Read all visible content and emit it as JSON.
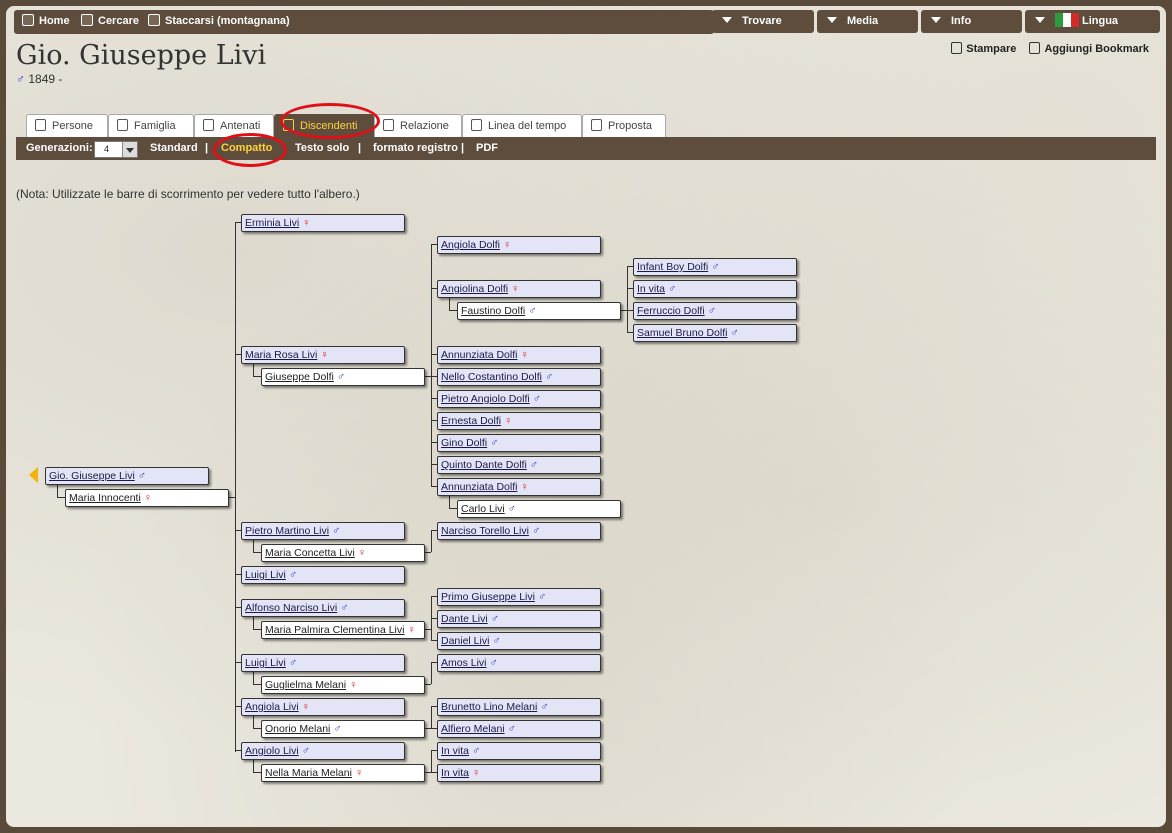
{
  "menu": {
    "home": "Home",
    "search": "Cercare",
    "logout": "Staccarsi (montagnana)",
    "find": "Trovare",
    "media": "Media",
    "info": "Info",
    "language": "Lingua"
  },
  "person": {
    "name": "Gio. Giuseppe Livi",
    "sex_symbol": "♂",
    "dates": "1849 -"
  },
  "header_links": {
    "print": "Stampare",
    "bookmark": "Aggiungi Bookmark"
  },
  "tabs": [
    "Persone",
    "Famiglia",
    "Antenati",
    "Discendenti",
    "Relazione",
    "Linea del tempo",
    "Proposta"
  ],
  "active_tab": "Discendenti",
  "subnav": {
    "generations_label": "Generazioni:",
    "generations_value": "4",
    "sep": "|",
    "options": [
      "Standard",
      "Compatto",
      "Testo solo",
      "formato registro",
      "PDF"
    ],
    "active_option": "Compatto"
  },
  "note": "(Nota: Utilizzate le barre di scorrimento per vedere tutto l'albero.)",
  "highlight_color": "#e0101a",
  "active_color": "#ffd23a",
  "tree": [
    {
      "name": "Gio. Giuseppe Livi",
      "sex": "♂",
      "type": "person"
    },
    {
      "name": "Maria Innocenti",
      "sex": "♀",
      "type": "spouse"
    },
    {
      "name": "Erminia Livi",
      "sex": "♀",
      "type": "person"
    },
    {
      "name": "Maria Rosa Livi",
      "sex": "♀",
      "type": "person"
    },
    {
      "name": "Giuseppe Dolfi",
      "sex": "♂",
      "type": "spouse"
    },
    {
      "name": "Angiola Dolfi",
      "sex": "♀",
      "type": "person"
    },
    {
      "name": "Angiolina Dolfi",
      "sex": "♀",
      "type": "person"
    },
    {
      "name": "Faustino Dolfi",
      "sex": "♂",
      "type": "spouse"
    },
    {
      "name": "Infant Boy Dolfi",
      "sex": "♂",
      "type": "person"
    },
    {
      "name": "In vita",
      "sex": "♂",
      "type": "person"
    },
    {
      "name": "Ferruccio Dolfi",
      "sex": "♂",
      "type": "person"
    },
    {
      "name": "Samuel Bruno Dolfi",
      "sex": "♂",
      "type": "person"
    },
    {
      "name": "Annunziata Dolfi",
      "sex": "♀",
      "type": "person"
    },
    {
      "name": "Nello Costantino Dolfi",
      "sex": "♂",
      "type": "person"
    },
    {
      "name": "Pietro Angiolo Dolfi",
      "sex": "♂",
      "type": "person"
    },
    {
      "name": "Ernesta Dolfi",
      "sex": "♀",
      "type": "person"
    },
    {
      "name": "Gino Dolfi",
      "sex": "♂",
      "type": "person"
    },
    {
      "name": "Quinto Dante Dolfi",
      "sex": "♂",
      "type": "person"
    },
    {
      "name": "Annunziata Dolfi",
      "sex": "♀",
      "type": "person"
    },
    {
      "name": "Carlo Livi",
      "sex": "♂",
      "type": "spouse"
    },
    {
      "name": "Pietro Martino Livi",
      "sex": "♂",
      "type": "person"
    },
    {
      "name": "Maria Concetta Livi",
      "sex": "♀",
      "type": "spouse"
    },
    {
      "name": "Narciso Torello Livi",
      "sex": "♂",
      "type": "person"
    },
    {
      "name": "Luigi Livi",
      "sex": "♂",
      "type": "person"
    },
    {
      "name": "Alfonso Narciso Livi",
      "sex": "♂",
      "type": "person"
    },
    {
      "name": "Maria Palmira Clementina Livi",
      "sex": "♀",
      "type": "spouse"
    },
    {
      "name": "Primo Giuseppe Livi",
      "sex": "♂",
      "type": "person"
    },
    {
      "name": "Dante Livi",
      "sex": "♂",
      "type": "person"
    },
    {
      "name": "Daniel Livi",
      "sex": "♂",
      "type": "person"
    },
    {
      "name": "Luigi Livi",
      "sex": "♂",
      "type": "person"
    },
    {
      "name": "Guglielma Melani",
      "sex": "♀",
      "type": "spouse"
    },
    {
      "name": "Amos Livi",
      "sex": "♂",
      "type": "person"
    },
    {
      "name": "Angiola Livi",
      "sex": "♀",
      "type": "person"
    },
    {
      "name": "Onorio Melani",
      "sex": "♂",
      "type": "spouse"
    },
    {
      "name": "Brunetto Lino Melani",
      "sex": "♂",
      "type": "person"
    },
    {
      "name": "Alfiero Melani",
      "sex": "♂",
      "type": "person"
    },
    {
      "name": "Angiolo Livi",
      "sex": "♂",
      "type": "person"
    },
    {
      "name": "Nella Maria Melani",
      "sex": "♀",
      "type": "spouse"
    },
    {
      "name": "In vita",
      "sex": "♂",
      "type": "person"
    },
    {
      "name": "In vita",
      "sex": "♀",
      "type": "person"
    }
  ]
}
